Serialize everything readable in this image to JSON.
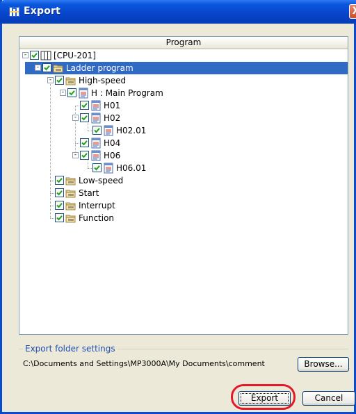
{
  "window": {
    "title": "Export",
    "close_glyph": "X"
  },
  "tree": {
    "column_header": "Program",
    "nodes": [
      {
        "id": "cpu",
        "label": "[CPU-201]",
        "icon": "cpu-icon",
        "checked": true,
        "expander": "-"
      },
      {
        "id": "ladder",
        "label": "Ladder program",
        "icon": "folder-icon",
        "checked": true,
        "expander": "-",
        "selected": true
      },
      {
        "id": "high-speed",
        "label": "High-speed",
        "icon": "folder-icon",
        "checked": true,
        "expander": "-"
      },
      {
        "id": "main-program",
        "label": "H : Main Program",
        "icon": "program-icon",
        "checked": true,
        "expander": "-"
      },
      {
        "id": "h01",
        "label": "H01",
        "icon": "program-icon",
        "checked": true
      },
      {
        "id": "h02",
        "label": "H02",
        "icon": "program-icon",
        "checked": true,
        "expander": "-"
      },
      {
        "id": "h02-01",
        "label": "H02.01",
        "icon": "program-icon",
        "checked": true
      },
      {
        "id": "h04",
        "label": "H04",
        "icon": "program-icon",
        "checked": true
      },
      {
        "id": "h06",
        "label": "H06",
        "icon": "program-icon",
        "checked": true,
        "expander": "-"
      },
      {
        "id": "h06-01",
        "label": "H06.01",
        "icon": "program-icon",
        "checked": true
      },
      {
        "id": "low-speed",
        "label": "Low-speed",
        "icon": "folder-icon",
        "checked": true
      },
      {
        "id": "start",
        "label": "Start",
        "icon": "folder-icon",
        "checked": true
      },
      {
        "id": "interrupt",
        "label": "Interrupt",
        "icon": "folder-icon",
        "checked": true
      },
      {
        "id": "function",
        "label": "Function",
        "icon": "folder-icon",
        "checked": true
      }
    ]
  },
  "export_settings": {
    "group_title": "Export folder settings",
    "folder_path": "C:\\Documents and Settings\\MP3000A\\My Documents\\comment",
    "browse_label": "Browse..."
  },
  "buttons": {
    "export_label": "Export",
    "cancel_label": "Cancel"
  },
  "colors": {
    "selection": "#316ac5",
    "highlight_ring": "#e3192b",
    "titlebar": "#0846cc"
  }
}
